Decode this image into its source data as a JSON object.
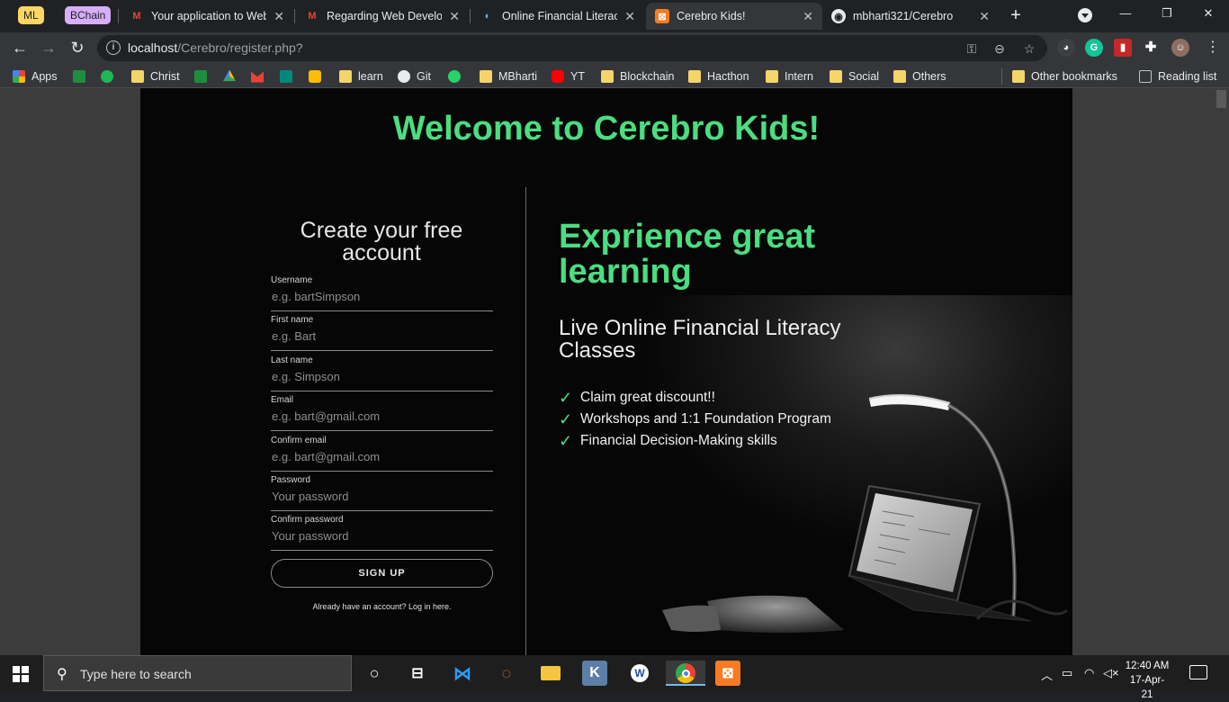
{
  "tab_groups": {
    "ml": "ML",
    "bchain": "BChain"
  },
  "tabs": [
    {
      "title": "Your application to Web",
      "icon": "gmail-icon"
    },
    {
      "title": "Regarding Web Developm",
      "icon": "gmail-icon"
    },
    {
      "title": "Online Financial Literacy",
      "icon": "site-icon"
    },
    {
      "title": "Cerebro Kids!",
      "icon": "xampp-icon",
      "active": true
    },
    {
      "title": "mbharti321/Cerebro",
      "icon": "github-icon"
    }
  ],
  "address_bar": {
    "host": "localhost",
    "path": "/Cerebro/register.php?"
  },
  "bookmarks": [
    {
      "label": "Apps",
      "icon": "apps-grid-icon"
    },
    {
      "label": "",
      "icon": "google-classroom-icon"
    },
    {
      "label": "",
      "icon": "spotify-icon"
    },
    {
      "label": "Christ",
      "icon": "folder-icon"
    },
    {
      "label": "",
      "icon": "google-classroom-icon"
    },
    {
      "label": "",
      "icon": "google-drive-icon"
    },
    {
      "label": "",
      "icon": "gmail-icon"
    },
    {
      "label": "",
      "icon": "google-meet-icon"
    },
    {
      "label": "",
      "icon": "keep-icon"
    },
    {
      "label": "learn",
      "icon": "folder-icon"
    },
    {
      "label": "Git",
      "icon": "github-icon"
    },
    {
      "label": "",
      "icon": "whatsapp-icon"
    },
    {
      "label": "MBharti",
      "icon": "folder-icon"
    },
    {
      "label": "YT",
      "icon": "youtube-icon"
    },
    {
      "label": "Blockchain",
      "icon": "folder-icon"
    },
    {
      "label": "Hacthon",
      "icon": "folder-icon"
    },
    {
      "label": "Intern",
      "icon": "folder-icon"
    },
    {
      "label": "Social",
      "icon": "folder-icon"
    },
    {
      "label": "Others",
      "icon": "folder-icon"
    }
  ],
  "other_bookmarks": "Other bookmarks",
  "reading_list": "Reading list",
  "page": {
    "welcome": "Welcome to Cerebro Kids!",
    "form_title": "Create your free account",
    "fields": [
      {
        "label": "Username",
        "placeholder": "e.g. bartSimpson"
      },
      {
        "label": "First name",
        "placeholder": "e.g. Bart"
      },
      {
        "label": "Last name",
        "placeholder": "e.g. Simpson"
      },
      {
        "label": "Email",
        "placeholder": "e.g. bart@gmail.com"
      },
      {
        "label": "Confirm email",
        "placeholder": "e.g. bart@gmail.com"
      },
      {
        "label": "Password",
        "placeholder": "Your password"
      },
      {
        "label": "Confirm password",
        "placeholder": "Your password"
      }
    ],
    "signup_label": "SIGN UP",
    "login_note": "Already have an account? Log in here.",
    "hero_title": "Exprience great learning",
    "hero_subtitle": "Live Online Financial Literacy Classes",
    "features": [
      "Claim great discount!!",
      "Workshops and 1:1 Foundation Program",
      "Financial Decision-Making skills"
    ],
    "accent_color": "#4ade80"
  },
  "taskbar": {
    "search_placeholder": "Type here to search",
    "time": "12:40 AM",
    "date": "17-Apr-21"
  }
}
